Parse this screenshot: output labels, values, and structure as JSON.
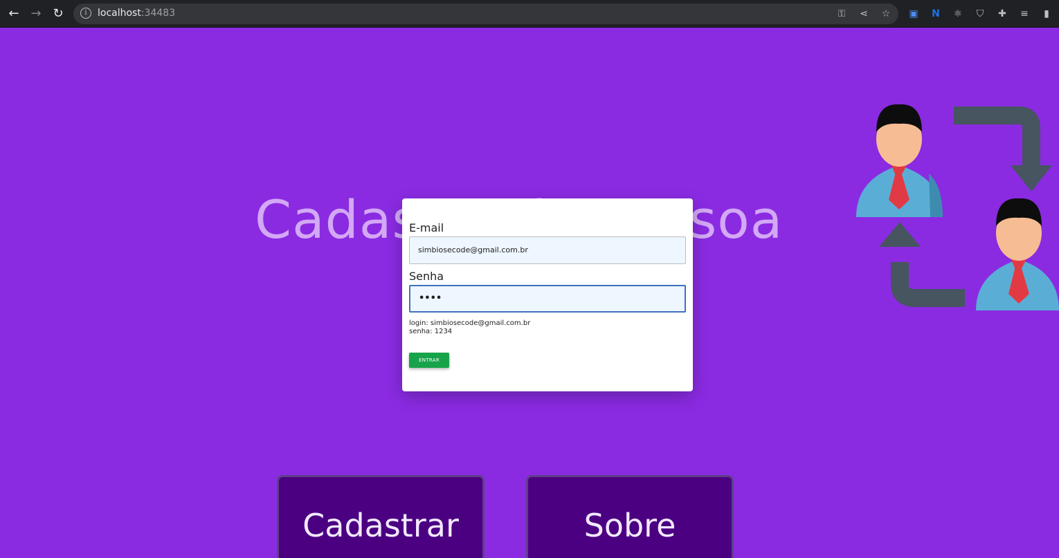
{
  "browser": {
    "url_host": "localhost",
    "url_port": ":34483",
    "back_icon": "back-arrow-icon",
    "forward_icon": "forward-arrow-icon",
    "reload_icon": "reload-icon"
  },
  "hero": {
    "title": "Cadastro de Pessoa"
  },
  "login_modal": {
    "email_label": "E-mail",
    "email_value": "simbiosecode@gmail.com.br",
    "password_label": "Senha",
    "password_value": "••••",
    "hint_login": "login: simbiosecode@gmail.com.br",
    "hint_password": "senha: 1234",
    "submit_label": "ENTRAR"
  },
  "buttons": {
    "register_label": "Cadastrar",
    "about_label": "Sobre"
  },
  "colors": {
    "background": "#8a2be2",
    "button_bg": "#4b0082",
    "submit": "#17a34a"
  }
}
